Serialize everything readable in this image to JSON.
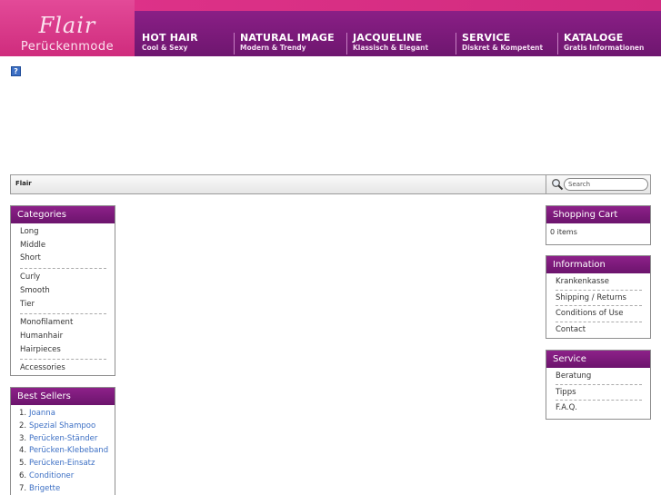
{
  "header": {
    "logo_script": "Flair",
    "logo_sub": "Perückenmode",
    "nav": [
      {
        "title": "HOT HAIR",
        "sub": "Cool & Sexy"
      },
      {
        "title": "NATURAL IMAGE",
        "sub": "Modern & Trendy"
      },
      {
        "title": "JACQUELINE",
        "sub": "Klassisch & Elegant"
      },
      {
        "title": "SERVICE",
        "sub": "Diskret & Kompetent"
      },
      {
        "title": "KATALOGE",
        "sub": "Gratis Informationen"
      }
    ]
  },
  "help_icon": "?",
  "breadcrumb": "Flair",
  "search": {
    "placeholder": "Search"
  },
  "categories": {
    "title": "Categories",
    "groups": [
      [
        "Long",
        "Middle",
        "Short"
      ],
      [
        "Curly",
        "Smooth",
        "Tier"
      ],
      [
        "Monofilament",
        "Humanhair",
        "Hairpieces"
      ],
      [
        "Accessories"
      ]
    ]
  },
  "best_sellers": {
    "title": "Best Sellers",
    "items": [
      {
        "num": "1.",
        "name": "Joanna"
      },
      {
        "num": "2.",
        "name": "Spezial Shampoo"
      },
      {
        "num": "3.",
        "name": "Perücken-Ständer"
      },
      {
        "num": "4.",
        "name": "Perücken-Klebeband"
      },
      {
        "num": "5.",
        "name": "Perücken-Einsatz"
      },
      {
        "num": "6.",
        "name": "Conditioner"
      },
      {
        "num": "7.",
        "name": "Brigette"
      }
    ]
  },
  "shopping_cart": {
    "title": "Shopping Cart",
    "content": "0 items"
  },
  "information": {
    "title": "Information",
    "items": [
      "Krankenkasse",
      "Shipping / Returns",
      "Conditions of Use",
      "Contact"
    ]
  },
  "service": {
    "title": "Service",
    "items": [
      "Beratung",
      "Tipps",
      "F.A.Q."
    ]
  }
}
